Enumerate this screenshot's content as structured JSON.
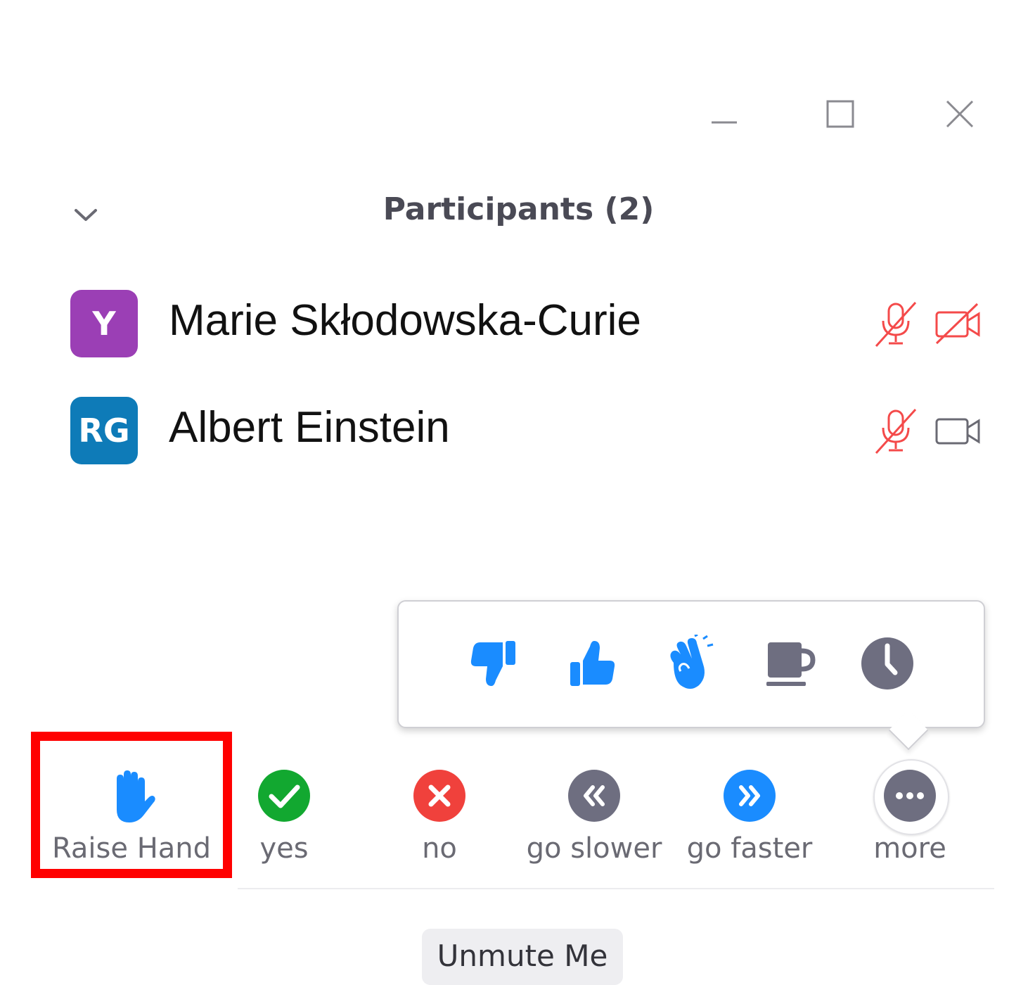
{
  "window_controls": {
    "minimize_icon": "minimize-icon",
    "maximize_icon": "maximize-icon",
    "close_icon": "close-icon"
  },
  "panel": {
    "title": "Participants (2)",
    "collapse_icon": "chevron-down-icon"
  },
  "participants": [
    {
      "initials": "Y",
      "name": "Marie Skłodowska-Curie",
      "avatar_color": "#9b3fb5",
      "mic": "muted",
      "video": "off"
    },
    {
      "initials": "RG",
      "name": "Albert Einstein",
      "avatar_color": "#0e7bb8",
      "mic": "muted",
      "video": "on"
    }
  ],
  "reactions": [
    {
      "icon": "thumbs-down-icon",
      "color": "#1a8cff"
    },
    {
      "icon": "thumbs-up-icon",
      "color": "#1a8cff"
    },
    {
      "icon": "clapping-hands-icon",
      "color": "#1a8cff"
    },
    {
      "icon": "coffee-icon",
      "color": "#6e6e80"
    },
    {
      "icon": "clock-icon",
      "color": "#6e6e80"
    }
  ],
  "toolbar": {
    "raise_hand": "Raise Hand",
    "yes": "yes",
    "no": "no",
    "go_slower": "go slower",
    "go_faster": "go faster",
    "more": "more"
  },
  "colors": {
    "accent_blue": "#1a8cff",
    "yes_green": "#12a830",
    "no_red": "#f0413c",
    "neutral_gray": "#6e6e80",
    "muted_red": "#f44a4a",
    "highlight_red": "#ff0000"
  },
  "footer": {
    "unmute_label": "Unmute Me"
  }
}
